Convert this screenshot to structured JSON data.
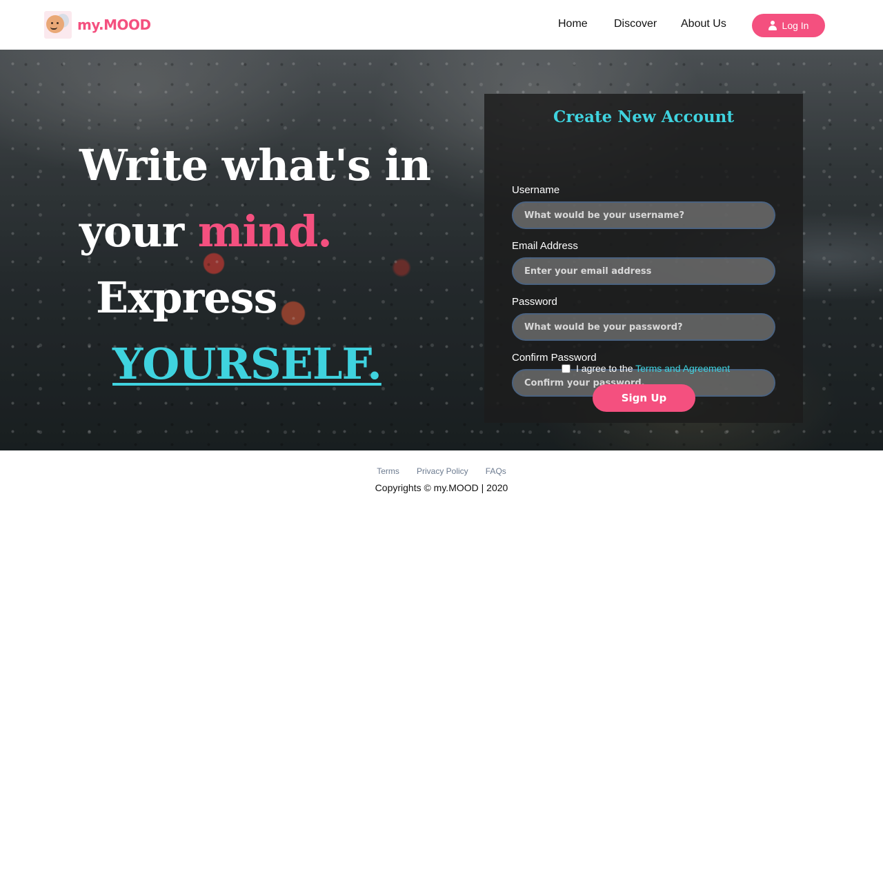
{
  "brand": {
    "name": "my.MOOD",
    "logo_icon": "mood-faces-logo"
  },
  "nav": {
    "links": [
      "Home",
      "Discover",
      "About Us"
    ],
    "login_label": "Log In",
    "login_icon": "user-icon"
  },
  "hero": {
    "line1": "Write what's in",
    "line2_prefix": "your ",
    "line2_highlight": "mind.",
    "line3": "Express",
    "line4": "YOURSELF."
  },
  "form": {
    "title": "Create New Account",
    "fields": [
      {
        "label": "Username",
        "placeholder": "What would be your username?",
        "value": ""
      },
      {
        "label": "Email Address",
        "placeholder": "Enter your email address",
        "value": ""
      },
      {
        "label": "Password",
        "placeholder": "What would be your password?",
        "value": ""
      },
      {
        "label": "Confirm Password",
        "placeholder": "Confirm your password.",
        "value": ""
      }
    ],
    "agree_text": "I agree to the ",
    "agree_link": "Terms and Agreement",
    "agree_checked": false,
    "submit_label": "Sign Up"
  },
  "footer": {
    "links": [
      "Terms",
      "Privacy Policy",
      "FAQs"
    ],
    "copyright": "Copyrights © my.MOOD | 2020"
  },
  "colors": {
    "accent_pink": "#f4507f",
    "accent_cyan": "#3fd3df"
  }
}
